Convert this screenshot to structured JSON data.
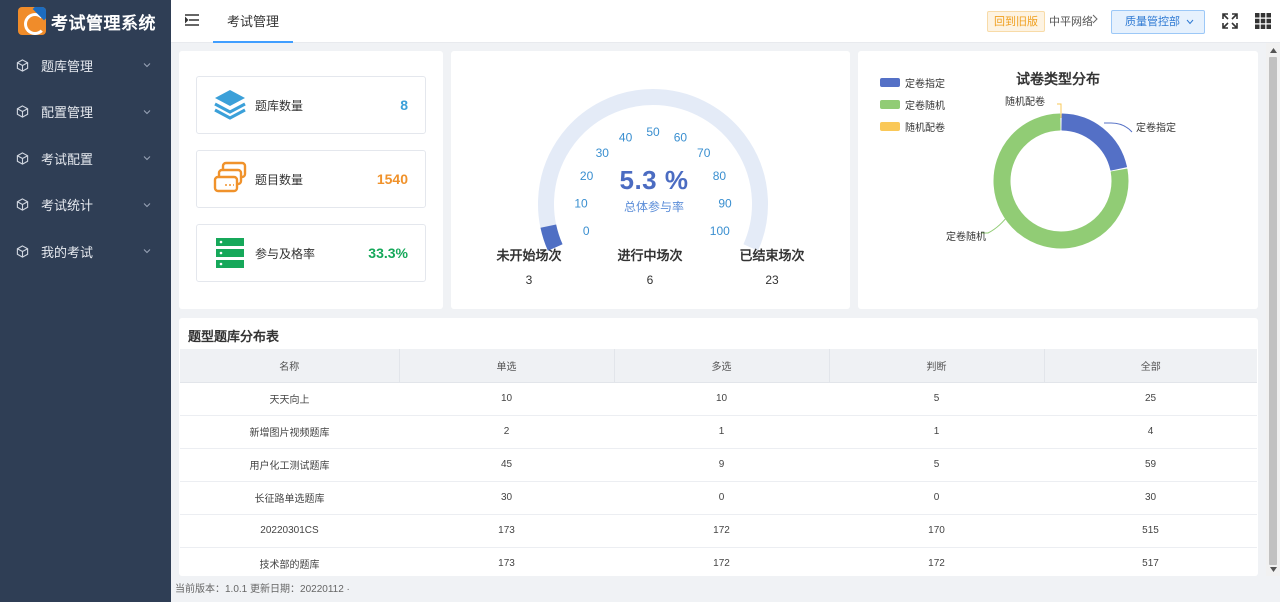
{
  "app": {
    "title": "考试管理系统"
  },
  "sidebar": {
    "items": [
      {
        "label": "题库管理",
        "icon": "cube-icon"
      },
      {
        "label": "配置管理",
        "icon": "cube-icon"
      },
      {
        "label": "考试配置",
        "icon": "cube-icon"
      },
      {
        "label": "考试统计",
        "icon": "cube-icon"
      },
      {
        "label": "我的考试",
        "icon": "cube-icon"
      }
    ]
  },
  "header": {
    "tab": "考试管理",
    "old_version_label": "回到旧版",
    "company": "中平网络",
    "department": "质量管控部"
  },
  "stats": [
    {
      "label": "题库数量",
      "value": "8",
      "color": "#3ba0d9",
      "icon": "layers-icon"
    },
    {
      "label": "题目数量",
      "value": "1540",
      "color": "#f0922b",
      "icon": "cards-icon"
    },
    {
      "label": "参与及格率",
      "value": "33.3%",
      "color": "#16a85a",
      "icon": "server-icon"
    }
  ],
  "gauge": {
    "value": 5.3,
    "value_text": "5.3 %",
    "label": "总体参与率",
    "ticks": [
      "0",
      "10",
      "20",
      "30",
      "40",
      "50",
      "60",
      "70",
      "80",
      "90",
      "100"
    ],
    "counts": [
      {
        "title": "未开始场次",
        "value": "3"
      },
      {
        "title": "进行中场次",
        "value": "6"
      },
      {
        "title": "已结束场次",
        "value": "23"
      }
    ]
  },
  "chart_data": {
    "type": "pie",
    "title": "试卷类型分布",
    "legend": [
      "定卷指定",
      "定卷随机",
      "随机配卷"
    ],
    "slices": [
      {
        "name": "定卷指定",
        "value": 7,
        "color": "#5470c6"
      },
      {
        "name": "定卷随机",
        "value": 25,
        "color": "#91cc75"
      },
      {
        "name": "随机配卷",
        "value": 0,
        "color": "#fac858"
      }
    ],
    "legend_position": "top-left"
  },
  "table": {
    "title": "题型题库分布表",
    "columns": [
      "名称",
      "单选",
      "多选",
      "判断",
      "全部"
    ],
    "rows": [
      [
        "天天向上",
        "10",
        "10",
        "5",
        "25"
      ],
      [
        "新增图片视频题库",
        "2",
        "1",
        "1",
        "4"
      ],
      [
        "用户化工测试题库",
        "45",
        "9",
        "5",
        "59"
      ],
      [
        "长征路单选题库",
        "30",
        "0",
        "0",
        "30"
      ],
      [
        "20220301CS",
        "173",
        "172",
        "170",
        "515"
      ],
      [
        "技术部的题库",
        "173",
        "172",
        "172",
        "517"
      ]
    ]
  },
  "footer": {
    "text": "当前版本：1.0.1 更新日期：20220112 ·"
  }
}
